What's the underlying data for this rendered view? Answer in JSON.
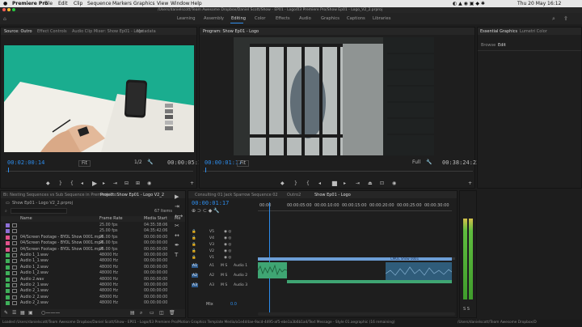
{
  "menubar": {
    "apple": "",
    "app": "Premiere Pro",
    "items": [
      "File",
      "Edit",
      "Clip",
      "Sequence",
      "Markers",
      "Graphics",
      "View",
      "Window",
      "Help"
    ],
    "clock": "Thu 20 May 16:12"
  },
  "path": "/Users/danielscott/Team Awesome Dropbox/Daniel Scott/Show - EP01 - Logo/03 Premiere Pro/Show Ep01 - Logo_V2_2.prproj",
  "workspaces": [
    "Learning",
    "Assembly",
    "Editing",
    "Color",
    "Effects",
    "Audio",
    "Graphics",
    "Captions",
    "Libraries"
  ],
  "active_workspace": "Editing",
  "source": {
    "tabs": [
      "Source: Outro",
      "Effect Controls",
      "Audio Clip Mixer: Show Ep01 - Logo",
      "Metadata"
    ],
    "timecode": "00:02:00:14",
    "fit": "Fit",
    "scale": "1/2",
    "duration": "00:00:05:11"
  },
  "program": {
    "tab": "Program: Show Ep01 - Logo",
    "timecode": "00:00:01:17",
    "fit": "Fit",
    "scale": "Full",
    "duration": "00:38:24:23"
  },
  "essential": {
    "tabs": [
      "Essential Graphics",
      "Lumetri Color"
    ],
    "subtabs": [
      "Browse",
      "Edit"
    ]
  },
  "project": {
    "tabs": [
      "Bi: Nesting Sequences vs Sub Sequence in Premiere Pro",
      "Project: Show Ep01 - Logo V2_2"
    ],
    "filename": "Show Ep01 - Logo V2_2.prproj",
    "items_count": "67 Items",
    "columns": [
      "Name",
      "Frame Rate",
      "Media Start",
      "Me"
    ],
    "rows": [
      {
        "name": "",
        "fr": "25.00 fps",
        "ms": "04:35:38:06",
        "color": "#8d6fd6"
      },
      {
        "name": "",
        "fr": "25.00 fps",
        "ms": "04:35:42:06",
        "color": "#8d6fd6"
      },
      {
        "name": "04/Screen Footage - BYOL Show 0001.mp4",
        "fr": "25.00 fps",
        "ms": "00:00:00:00",
        "color": "#e2528c"
      },
      {
        "name": "04/Screen Footage - BYOL Show 0001.mp4",
        "fr": "25.00 fps",
        "ms": "00:00:00:00",
        "color": "#e2528c"
      },
      {
        "name": "04/Screen Footage - BYOL Show 0001.mp4",
        "fr": "25.00 fps",
        "ms": "00:00:00:00",
        "color": "#e2528c"
      },
      {
        "name": "Audio 1_1.wav",
        "fr": "48000 Hz",
        "ms": "00:00:00:00",
        "color": "#3fb05a"
      },
      {
        "name": "Audio 1_1.wav",
        "fr": "48000 Hz",
        "ms": "00:00:00:00",
        "color": "#3fb05a"
      },
      {
        "name": "Audio 1_2.wav",
        "fr": "48000 Hz",
        "ms": "00:00:00:00",
        "color": "#3fb05a"
      },
      {
        "name": "Audio 1_2.wav",
        "fr": "48000 Hz",
        "ms": "00:00:00:00",
        "color": "#3fb05a"
      },
      {
        "name": "Audio 2.wav",
        "fr": "48000 Hz",
        "ms": "00:00:00:00",
        "color": "#3fb05a"
      },
      {
        "name": "Audio 2_1.wav",
        "fr": "48000 Hz",
        "ms": "00:00:00:00",
        "color": "#3fb05a"
      },
      {
        "name": "Audio 2_1.wav",
        "fr": "48000 Hz",
        "ms": "00:00:00:00",
        "color": "#3fb05a"
      },
      {
        "name": "Audio 2_2.wav",
        "fr": "48000 Hz",
        "ms": "00:00:00:00",
        "color": "#3fb05a"
      },
      {
        "name": "Audio 2_2.wav",
        "fr": "48000 Hz",
        "ms": "00:00:00:00",
        "color": "#3fb05a"
      }
    ]
  },
  "timeline": {
    "tabs": [
      "Consulting 01 Jack Sparrow",
      "Sequence 02",
      "Outro2",
      "Show Ep01 - Logo"
    ],
    "timecode": "00:00:01:17",
    "ruler": [
      "00:00",
      "00:00:05:00",
      "00:00:10:00",
      "00:00:15:00",
      "00:00:20:00",
      "00:00:25:00",
      "00:00:30:00"
    ],
    "video_tracks": [
      "V5",
      "V4",
      "V3",
      "V2",
      "V1"
    ],
    "audio_tracks": [
      "A1",
      "A2",
      "A3"
    ],
    "audio_labels": [
      "Audio 1",
      "Audio 2",
      "Audio 3"
    ],
    "master": "Mix",
    "master_val": "0.0",
    "clip_label": "CMOL Show 0001"
  },
  "status": {
    "left": "Loaded /Users/danielscott/Team Awesome Dropbox/Daniel Scott/Show - EP01 - Logo/03 Premiere Pro/Motion Graphics Template Media/a1e4d4ae-9acd-4495-af5-ebe1a3b6b1a4/Text Message - Style 01.aegraphic (16 remaining)",
    "right": "/Users/danielscott/Team Awesome Dropbox/D"
  },
  "colors": {
    "accent": "#2d8ceb",
    "video_clip": "#6c9ed6",
    "audio_clip": "#3fa573",
    "source_bg": "#1aad8f",
    "meter": "#4caf3a"
  }
}
